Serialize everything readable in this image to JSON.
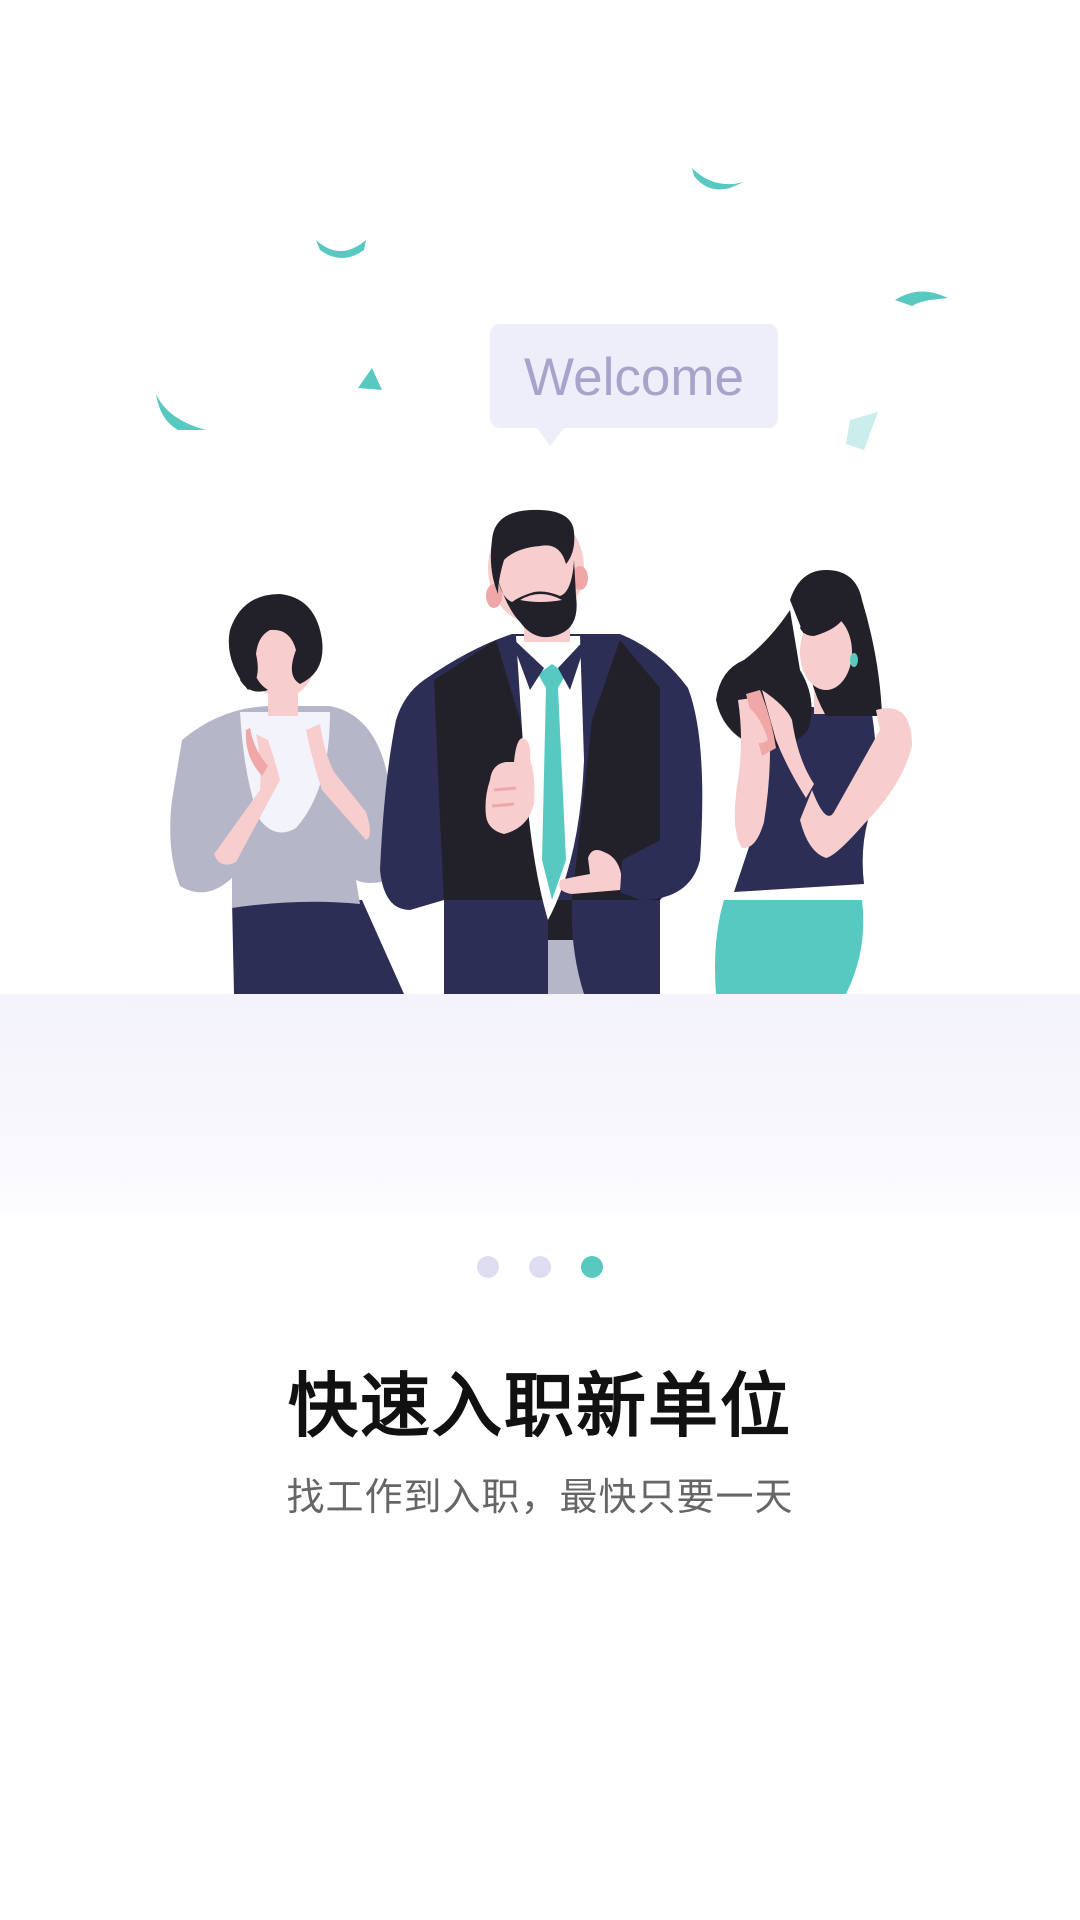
{
  "hero": {
    "speech_bubble_text": "Welcome",
    "illustration": "three-people-clapping-welcome",
    "colors": {
      "accent": "#57c9c1",
      "navy": "#2d2e55",
      "dark": "#222028",
      "skin": "#f7cdcd",
      "bubble": "#eeeefa"
    }
  },
  "pager": {
    "total_pages": 3,
    "current_page": 3,
    "active_color": "#57c9c1",
    "inactive_color": "#dedef2"
  },
  "content": {
    "title": "快速入职新单位",
    "subtitle": "找工作到入职，最快只要一天"
  }
}
